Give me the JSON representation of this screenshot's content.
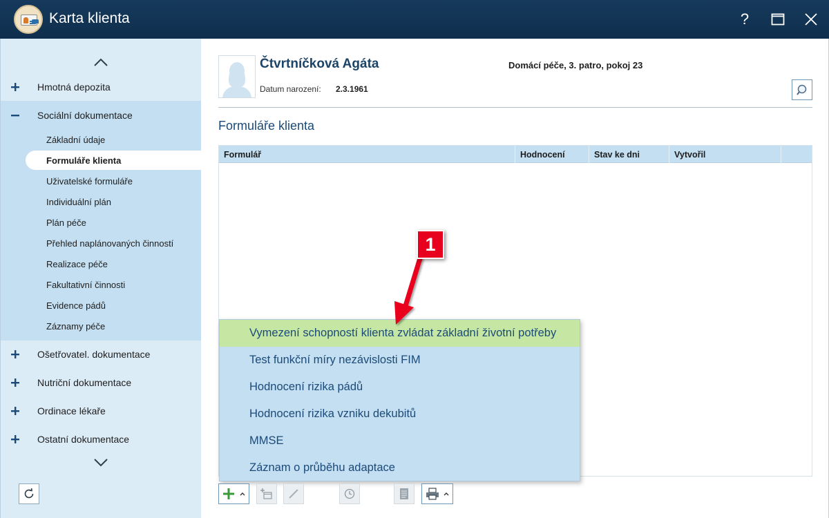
{
  "window": {
    "title": "Karta klienta",
    "buttons": {
      "help": "?",
      "maximize": "maximize-icon",
      "close": "close-icon"
    }
  },
  "sidebar": {
    "sections": [
      {
        "label": "Hmotná depozita",
        "sign": "+"
      },
      {
        "label": "Sociální dokumentace",
        "sign": "−",
        "expanded": true,
        "items": [
          {
            "label": "Základní údaje"
          },
          {
            "label": "Formuláře klienta",
            "active": true
          },
          {
            "label": "Uživatelské formuláře"
          },
          {
            "label": "Individuální plán"
          },
          {
            "label": "Plán péče"
          },
          {
            "label": "Přehled naplánovaných činností"
          },
          {
            "label": "Realizace péče"
          },
          {
            "label": "Fakultativní činnosti"
          },
          {
            "label": "Evidence pádů"
          },
          {
            "label": "Záznamy péče"
          }
        ]
      },
      {
        "label": "Ošetřovatel. dokumentace",
        "sign": "+"
      },
      {
        "label": "Nutriční dokumentace",
        "sign": "+"
      },
      {
        "label": "Ordinace lékaře",
        "sign": "+"
      },
      {
        "label": "Ostatní dokumentace",
        "sign": "+"
      }
    ]
  },
  "client": {
    "name": "Čtvrtníčková Agáta",
    "address": "Domácí péče, 3. patro, pokoj 23",
    "dob_label": "Datum narození:",
    "dob_value": "2.3.1961"
  },
  "main": {
    "section_title": "Formuláře klienta",
    "columns": [
      "Formulář",
      "Hodnocení",
      "Stav ke dni",
      "Vytvořil"
    ]
  },
  "dropdown": {
    "items": [
      "Vymezení schopností klienta zvládat základní životní potřeby",
      "Test funkční míry nezávislosti FIM",
      "Hodnocení rizika pádů",
      "Hodnocení rizika vzniku dekubitů",
      "MMSE",
      "Záznam o průběhu adaptace"
    ],
    "highlighted_index": 0
  },
  "annotation": {
    "badge": "1",
    "color": "#e8001f"
  },
  "colors": {
    "titlebar": "#163a5c",
    "sidebar_bg": "#dcecf7",
    "sidebar_expanded": "#c4dff1",
    "accent_text": "#1b4a78",
    "highlight": "#c6e7a4",
    "add_green": "#3a9a3a"
  }
}
